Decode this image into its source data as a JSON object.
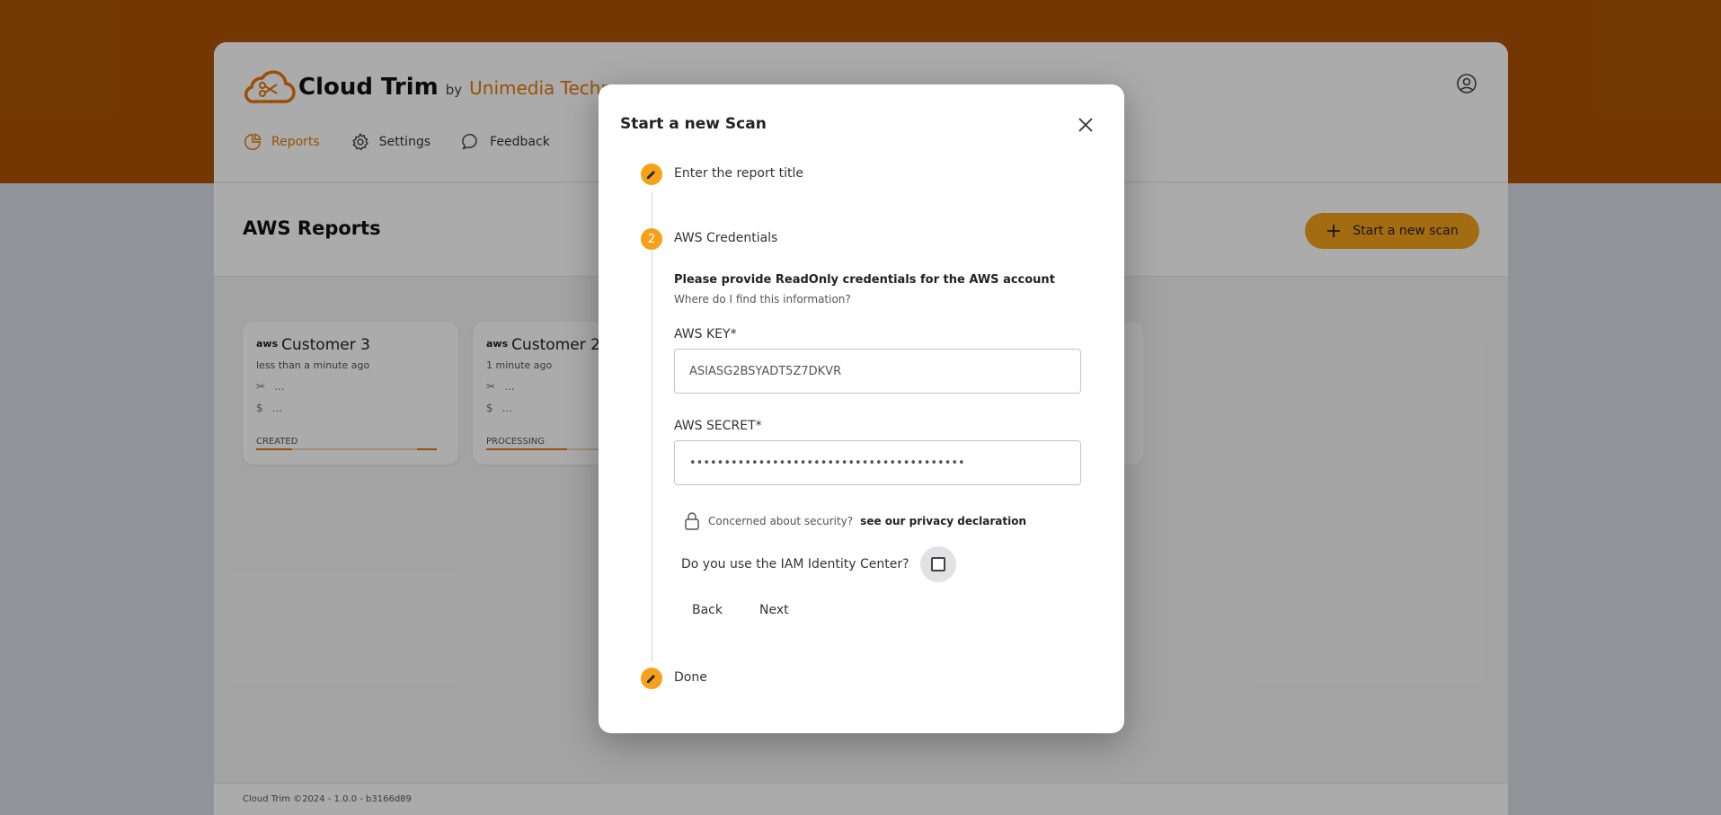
{
  "app": {
    "title": "Cloud Trim",
    "by": "by",
    "brand": "Unimedia Techno",
    "nav": [
      {
        "label": "Reports",
        "icon": "pie-chart-icon",
        "active": true
      },
      {
        "label": "Settings",
        "icon": "gear-icon",
        "active": false
      },
      {
        "label": "Feedback",
        "icon": "chat-bubble-icon",
        "active": false
      }
    ],
    "user_icon": "user-circle-icon"
  },
  "page": {
    "title": "AWS Reports",
    "new_scan_label": "Start a new scan"
  },
  "cards": [
    {
      "provider": "aws",
      "title": "Customer 3",
      "time": "less than a minute ago",
      "row1": "...",
      "row2": "...",
      "status": "CREATED",
      "progress": 0.2
    },
    {
      "provider": "aws",
      "title": "Customer 2",
      "time": "1 minute ago",
      "row1": "...",
      "row2": "...",
      "status": "PROCESSING",
      "progress": 0.45
    }
  ],
  "footer": {
    "text": "Cloud Trim ©2024 - 1.0.0 - b3166d89"
  },
  "modal": {
    "title": "Start a new Scan",
    "steps": [
      {
        "label": "Enter the report title",
        "marker": "pencil-icon"
      },
      {
        "label": "AWS Credentials",
        "marker": "2"
      },
      {
        "label": "Done",
        "marker": "pencil-icon"
      }
    ],
    "section_heading": "Please provide ReadOnly credentials for the AWS account",
    "section_help": "Where do I find this information?",
    "aws_key": {
      "label": "AWS KEY*",
      "value": "ASIASG2BSYADT5Z7DKVR"
    },
    "aws_secret": {
      "label": "AWS SECRET*",
      "value": "••••••••••••••••••••••••••••••••••••••••"
    },
    "security_text": "Concerned about security?",
    "security_link": "see our privacy declaration",
    "iam_question": "Do you use the IAM Identity Center?",
    "iam_checked": false,
    "back_label": "Back",
    "next_label": "Next"
  },
  "colors": {
    "accent": "#f5a11a",
    "brand_orange": "#e8760a",
    "header_band": "#ad5305"
  }
}
